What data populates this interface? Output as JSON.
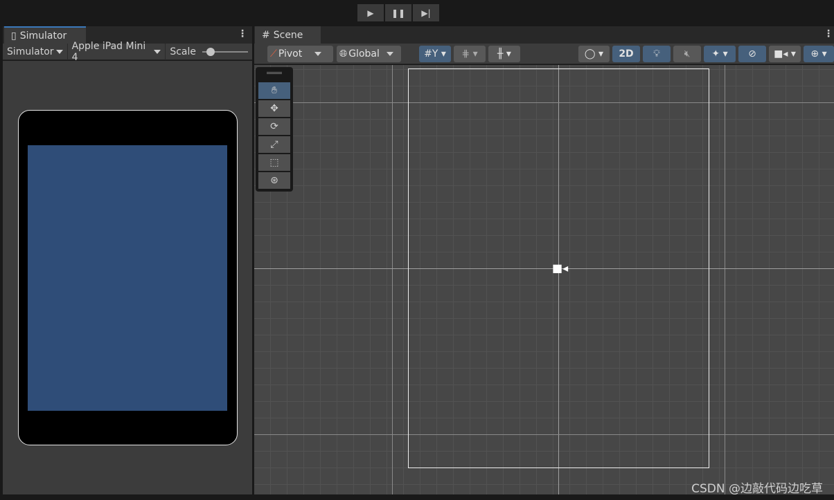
{
  "playbar": {
    "play": "▶",
    "pause": "❚❚",
    "step": "▶|"
  },
  "simulator": {
    "tab_title": "Simulator",
    "mode": "Simulator",
    "device": "Apple iPad Mini 4",
    "scale_label": "Scale",
    "scale_value": 0.1
  },
  "scene": {
    "tab_title": "Scene",
    "pivot": "Pivot",
    "global": "Global",
    "mode_2d": "2D"
  },
  "colors": {
    "accent": "#46607c",
    "device_screen": "#2f4d78"
  },
  "watermark": "CSDN @边敲代码边吃草"
}
